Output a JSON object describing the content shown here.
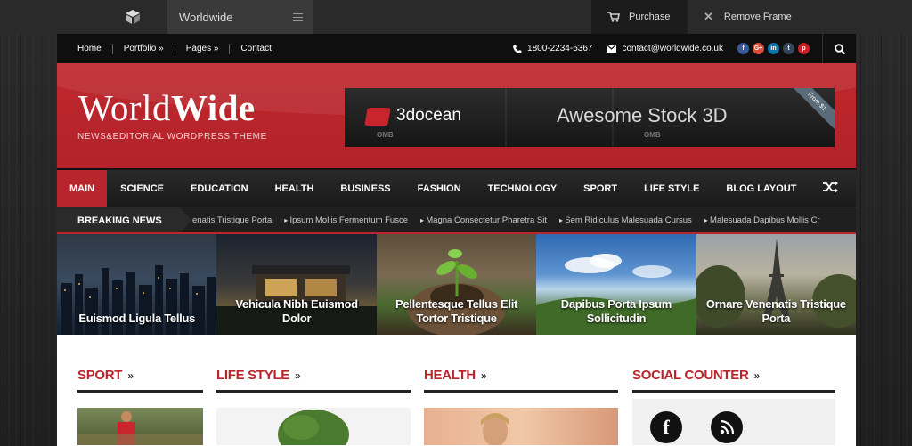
{
  "preview": {
    "site_name": "Worldwide",
    "purchase_label": "Purchase",
    "remove_label": "Remove Frame"
  },
  "topnav": {
    "links": [
      "Home",
      "Portfolio »",
      "Pages »",
      "Contact"
    ],
    "phone": "1800-2234-5367",
    "email": "contact@worldwide.co.uk",
    "social": [
      {
        "icon": "facebook-icon",
        "glyph": "f",
        "color": "#3b5998"
      },
      {
        "icon": "google-plus-icon",
        "glyph": "G+",
        "color": "#dd4b39"
      },
      {
        "icon": "linkedin-icon",
        "glyph": "in",
        "color": "#0e76a8"
      },
      {
        "icon": "tumblr-icon",
        "glyph": "t",
        "color": "#35465c"
      },
      {
        "icon": "pinterest-icon",
        "glyph": "p",
        "color": "#cb2027"
      }
    ]
  },
  "header": {
    "logo_part1": "World",
    "logo_part2": "Wide",
    "tagline": "NEWS&EDITORIAL WORDPRESS THEME",
    "banner_text1": "3docean",
    "banner_text2": "Awesome Stock 3D",
    "banner_omb": "OMB",
    "banner_ribbon": "From $1"
  },
  "mainnav": {
    "items": [
      "MAIN",
      "SCIENCE",
      "EDUCATION",
      "HEALTH",
      "BUSINESS",
      "FASHION",
      "TECHNOLOGY",
      "SPORT",
      "LIFE STYLE",
      "BLOG LAYOUT"
    ]
  },
  "breaking": {
    "label": "BREAKING NEWS",
    "items": [
      "enatis Tristique Porta",
      "Ipsum Mollis Fermentum Fusce",
      "Magna Consectetur Pharetra Sit",
      "Sem Ridiculus Malesuada Cursus",
      "Malesuada Dapibus Mollis Cr"
    ]
  },
  "slides": [
    "Euismod Ligula Tellus",
    "Vehicula Nibh Euismod Dolor",
    "Pellentesque Tellus Elit Tortor Tristique",
    "Dapibus Porta Ipsum Sollicitudin",
    "Ornare Venenatis Tristique Porta"
  ],
  "sections": {
    "sport": "SPORT",
    "lifestyle": "LIFE STYLE",
    "health": "HEALTH",
    "social": "SOCIAL COUNTER",
    "chevrons": "»"
  },
  "colors": {
    "brand_red": "#b9252c",
    "dark": "#1a1a1a"
  }
}
